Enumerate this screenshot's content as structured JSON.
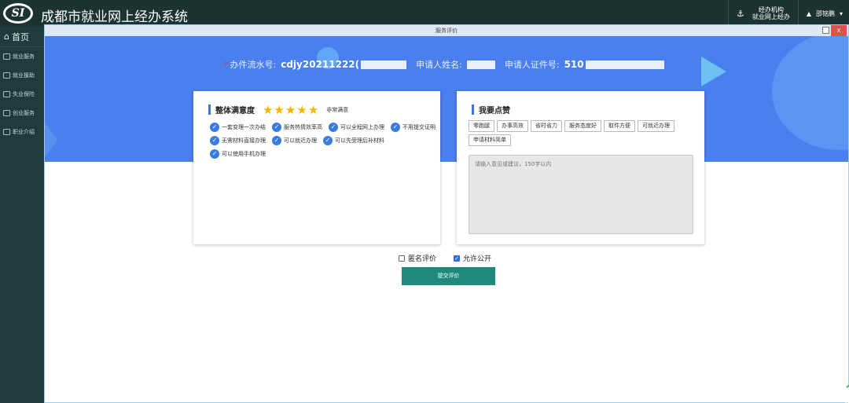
{
  "header": {
    "logo": "SI",
    "title": "成都市就业网上经办系统",
    "agency_line1": "经办机构",
    "agency_line2": "就业网上经办",
    "user_name": "邵铭鹏"
  },
  "sidebar": {
    "home": "首页",
    "items": [
      {
        "label": "就业服务"
      },
      {
        "label": "就业援助"
      },
      {
        "label": "失业保险"
      },
      {
        "label": "创业服务"
      },
      {
        "label": "职业介绍"
      }
    ]
  },
  "dialog": {
    "title": "服务评价",
    "close_label": "x"
  },
  "info": {
    "flow_label": "办件流水号:",
    "flow_value": "cdjy20211222(",
    "name_label": "申请人姓名:",
    "id_label": "申请人证件号:",
    "id_value": "510"
  },
  "overall": {
    "title": "整体满意度",
    "rating": 5,
    "rating_text": "非常满意",
    "tags": [
      "一套变理一次办结",
      "服务热情效率高",
      "可以全程网上办理",
      "不用提交证明",
      "无需材料直接办理",
      "可以就近办理",
      "可以先受理后补材料",
      "可以使用手机办理"
    ]
  },
  "praise": {
    "title": "我要点赞",
    "buttons": [
      "零跑腿",
      "办事高效",
      "省时省力",
      "服务态度好",
      "取件方便",
      "可就近办理",
      "申请材料简单"
    ],
    "placeholder": "请输入意见或建议，150字以内"
  },
  "options": {
    "anonymous": "匿名评价",
    "anonymous_checked": false,
    "public": "允许公开",
    "public_checked": true
  },
  "submit_label": "提交评价"
}
